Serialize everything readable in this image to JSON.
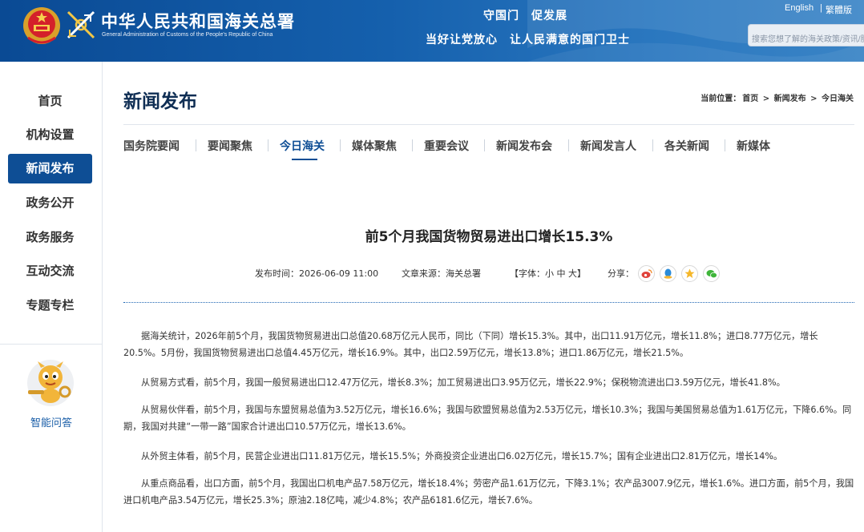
{
  "header": {
    "title_cn": "中华人民共和国海关总署",
    "title_en": "General Administration of Customs of the People's Republic of China",
    "slogan1": "守国门　促发展",
    "slogan2": "当好让党放心　让人民满意的国门卫士",
    "lang_en": "English",
    "lang_sep": "|",
    "lang_tw": "繁體版",
    "search_placeholder": "搜索您想了解的海关政策/资讯/服务"
  },
  "sidebar": {
    "items": [
      {
        "label": "首页"
      },
      {
        "label": "机构设置"
      },
      {
        "label": "新闻发布"
      },
      {
        "label": "政务公开"
      },
      {
        "label": "政务服务"
      },
      {
        "label": "互动交流"
      },
      {
        "label": "专题专栏"
      }
    ],
    "active_index": 2,
    "smart_qa": "智能问答"
  },
  "main": {
    "page_title": "新闻发布",
    "breadcrumb": {
      "prefix": "当前位置：",
      "items": [
        "首页",
        "新闻发布",
        "今日海关"
      ],
      "sep": ">"
    },
    "tabs": [
      {
        "label": "国务院要闻"
      },
      {
        "label": "要闻聚焦"
      },
      {
        "label": "今日海关"
      },
      {
        "label": "媒体聚焦"
      },
      {
        "label": "重要会议"
      },
      {
        "label": "新闻发布会"
      },
      {
        "label": "新闻发言人"
      },
      {
        "label": "各关新闻"
      },
      {
        "label": "新媒体"
      }
    ],
    "active_tab": 2
  },
  "article": {
    "title": "前5个月我国货物贸易进出口增长15.3%",
    "publish_time": "发布时间：2026-06-09 11:00",
    "source": "文章来源：海关总署",
    "font_label": "【字体：",
    "font_small": "小",
    "font_medium": "中",
    "font_large": "大",
    "font_close": "】",
    "share_label": "分享：",
    "paragraphs": [
      "据海关统计，2026年前5个月，我国货物贸易进出口总值20.68万亿元人民币，同比（下同）增长15.3%。其中，出口11.91万亿元，增长11.8%；进口8.77万亿元，增长20.5%。5月份，我国货物贸易进出口总值4.45万亿元，增长16.9%。其中，出口2.59万亿元，增长13.8%；进口1.86万亿元，增长21.5%。",
      "从贸易方式看，前5个月，我国一般贸易进出口12.47万亿元，增长8.3%；加工贸易进出口3.95万亿元，增长22.9%；保税物流进出口3.59万亿元，增长41.8%。",
      "从贸易伙伴看，前5个月，我国与东盟贸易总值为3.52万亿元，增长16.6%；我国与欧盟贸易总值为2.53万亿元，增长10.3%；我国与美国贸易总值为1.61万亿元，下降6.6%。同期，我国对共建“一带一路”国家合计进出口10.57万亿元，增长13.6%。",
      "从外贸主体看，前5个月，民营企业进出口11.81万亿元，增长15.5%；外商投资企业进出口6.02万亿元，增长15.7%；国有企业进出口2.81万亿元，增长14%。",
      "从重点商品看，出口方面，前5个月，我国出口机电产品7.58万亿元，增长18.4%；劳密产品1.61万亿元，下降3.1%；农产品3007.9亿元，增长1.6%。进口方面，前5个月，我国进口机电产品3.54万亿元，增长25.3%；原油2.18亿吨，减少4.8%；农产品6181.6亿元，增长7.6%。"
    ]
  },
  "colors": {
    "header_blue": "#0a4a94",
    "nav_active": "#0e4e95",
    "link_blue": "#1a5ea8"
  }
}
